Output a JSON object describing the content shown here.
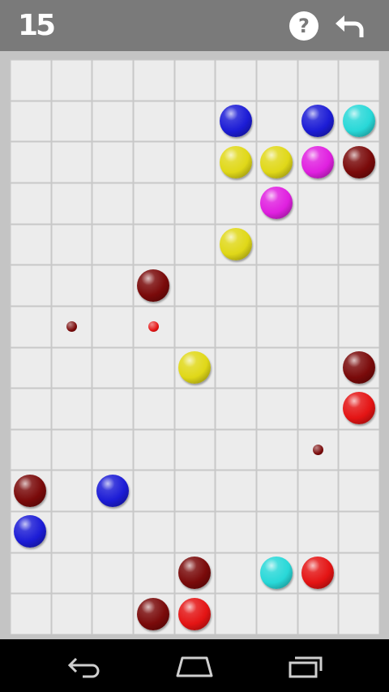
{
  "header": {
    "score": "15",
    "help_label": "?",
    "help_icon": "question-mark-icon",
    "undo_icon": "undo-arrow-icon",
    "background_color": "#7a7a7a"
  },
  "board": {
    "rows": 14,
    "cols": 9,
    "background_color": "#ececec",
    "line_color": "#c8c8c8",
    "colors": {
      "blue": "#1c1cd6",
      "cyan": "#28d8d8",
      "yellow": "#e0d818",
      "magenta": "#e020e0",
      "darkred": "#7a0a0a",
      "red": "#e41414"
    },
    "balls": [
      {
        "row": 1,
        "col": 5,
        "color": "blue"
      },
      {
        "row": 1,
        "col": 7,
        "color": "blue"
      },
      {
        "row": 1,
        "col": 8,
        "color": "cyan"
      },
      {
        "row": 2,
        "col": 5,
        "color": "yellow"
      },
      {
        "row": 2,
        "col": 6,
        "color": "yellow"
      },
      {
        "row": 2,
        "col": 7,
        "color": "magenta"
      },
      {
        "row": 2,
        "col": 8,
        "color": "darkred"
      },
      {
        "row": 3,
        "col": 6,
        "color": "magenta"
      },
      {
        "row": 4,
        "col": 5,
        "color": "yellow"
      },
      {
        "row": 5,
        "col": 3,
        "color": "darkred"
      },
      {
        "row": 7,
        "col": 4,
        "color": "yellow"
      },
      {
        "row": 7,
        "col": 8,
        "color": "darkred"
      },
      {
        "row": 8,
        "col": 8,
        "color": "red"
      },
      {
        "row": 10,
        "col": 0,
        "color": "darkred"
      },
      {
        "row": 10,
        "col": 2,
        "color": "blue"
      },
      {
        "row": 11,
        "col": 0,
        "color": "blue"
      },
      {
        "row": 12,
        "col": 4,
        "color": "darkred"
      },
      {
        "row": 12,
        "col": 6,
        "color": "cyan"
      },
      {
        "row": 12,
        "col": 7,
        "color": "red"
      },
      {
        "row": 13,
        "col": 3,
        "color": "darkred"
      },
      {
        "row": 13,
        "col": 4,
        "color": "red"
      }
    ],
    "next_balls": [
      {
        "row": 6,
        "col": 1,
        "color": "darkred"
      },
      {
        "row": 6,
        "col": 3,
        "color": "red"
      },
      {
        "row": 9,
        "col": 7,
        "color": "darkred"
      }
    ]
  },
  "navbar": {
    "back_icon": "back-arrow-icon",
    "home_icon": "home-icon",
    "recents_icon": "recent-apps-icon"
  }
}
